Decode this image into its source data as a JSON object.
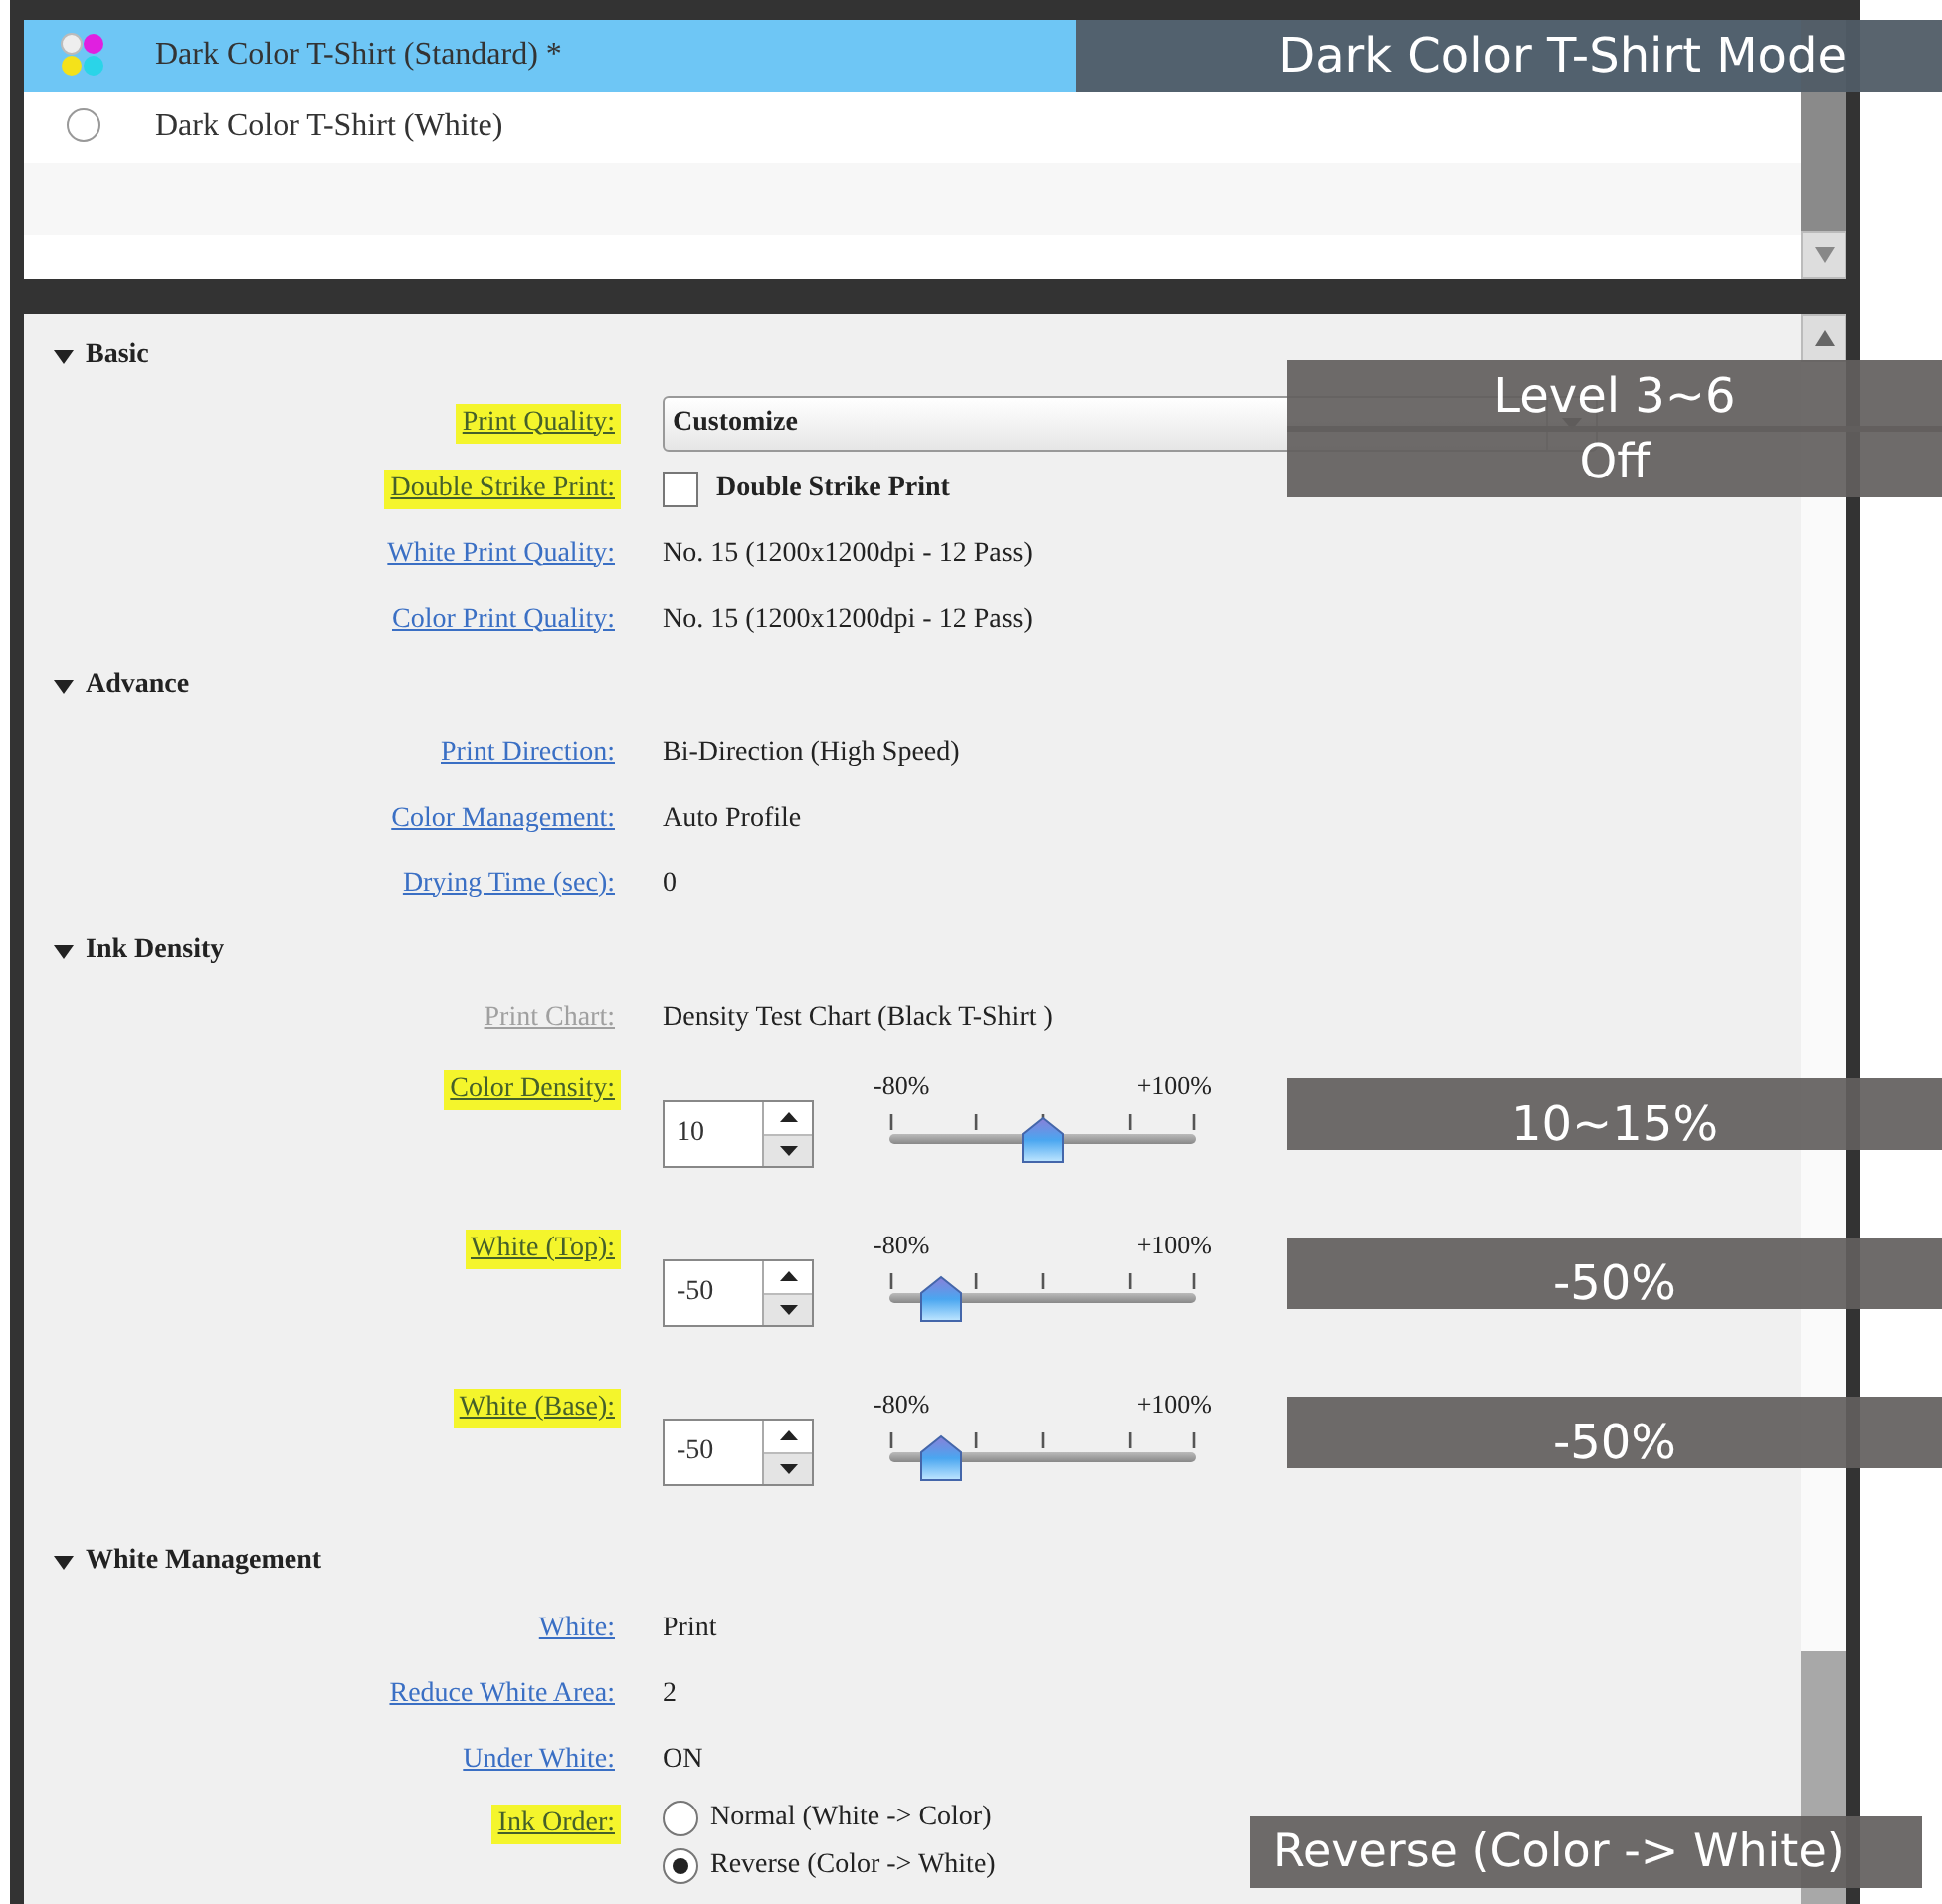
{
  "mode_list": {
    "items": [
      {
        "label": "Dark Color T-Shirt (Standard) *",
        "selected": true,
        "annotation": "Dark Color T-Shirt Mode"
      },
      {
        "label": "Dark Color T-Shirt (White)",
        "selected": false
      }
    ]
  },
  "sections": [
    {
      "title": "Basic",
      "expanded": true,
      "rows": [
        {
          "kind": "dropdown",
          "label": "Print Quality:",
          "highlighted": true,
          "disabled": false,
          "value": "Customize",
          "annotation": "Level 3~6"
        },
        {
          "kind": "checkbox",
          "label": "Double Strike Print:",
          "highlighted": true,
          "disabled": false,
          "text": "Double Strike Print",
          "checked": false,
          "annotation": "Off"
        },
        {
          "kind": "text",
          "label": "White Print Quality:",
          "highlighted": false,
          "disabled": false,
          "value": "No. 15 (1200x1200dpi - 12 Pass)"
        },
        {
          "kind": "text",
          "label": "Color Print Quality:",
          "highlighted": false,
          "disabled": false,
          "value": "No. 15 (1200x1200dpi - 12 Pass)"
        }
      ]
    },
    {
      "title": "Advance",
      "expanded": true,
      "rows": [
        {
          "kind": "text",
          "label": "Print Direction:",
          "highlighted": false,
          "disabled": false,
          "value": "Bi-Direction (High Speed)"
        },
        {
          "kind": "text",
          "label": "Color Management:",
          "highlighted": false,
          "disabled": false,
          "value": "Auto Profile"
        },
        {
          "kind": "text",
          "label": "Drying Time (sec):",
          "highlighted": false,
          "disabled": false,
          "value": "0"
        }
      ]
    },
    {
      "title": "Ink Density",
      "expanded": true,
      "rows": [
        {
          "kind": "text",
          "label": "Print Chart:",
          "highlighted": false,
          "disabled": true,
          "value": "Density Test Chart (Black T-Shirt )"
        },
        {
          "kind": "slider",
          "label": "Color Density:",
          "highlighted": true,
          "disabled": false,
          "value": "10",
          "min_label": "-80%",
          "max_label": "+100%",
          "level": 0.5,
          "annotation": "10~15%"
        },
        {
          "kind": "slider",
          "label": "White (Top):",
          "highlighted": true,
          "disabled": false,
          "value": "-50",
          "min_label": "-80%",
          "max_label": "+100%",
          "level": 0.167,
          "annotation": "-50%"
        },
        {
          "kind": "slider",
          "label": "White (Base):",
          "highlighted": true,
          "disabled": false,
          "value": "-50",
          "min_label": "-80%",
          "max_label": "+100%",
          "level": 0.167,
          "annotation": "-50%"
        }
      ]
    },
    {
      "title": "White Management",
      "expanded": true,
      "rows": [
        {
          "kind": "text",
          "label": "White:",
          "highlighted": false,
          "disabled": false,
          "value": "Print"
        },
        {
          "kind": "text",
          "label": "Reduce White Area:",
          "highlighted": false,
          "disabled": false,
          "value": "2"
        },
        {
          "kind": "text",
          "label": "Under White:",
          "highlighted": false,
          "disabled": false,
          "value": "ON"
        },
        {
          "kind": "radio",
          "label": "Ink Order:",
          "highlighted": true,
          "disabled": false,
          "options": [
            {
              "label": "Normal (White -> Color)",
              "selected": false
            },
            {
              "label": "Reverse (Color -> White)",
              "selected": true,
              "annotation": "Reverse (Color -> White)"
            }
          ]
        }
      ]
    }
  ]
}
